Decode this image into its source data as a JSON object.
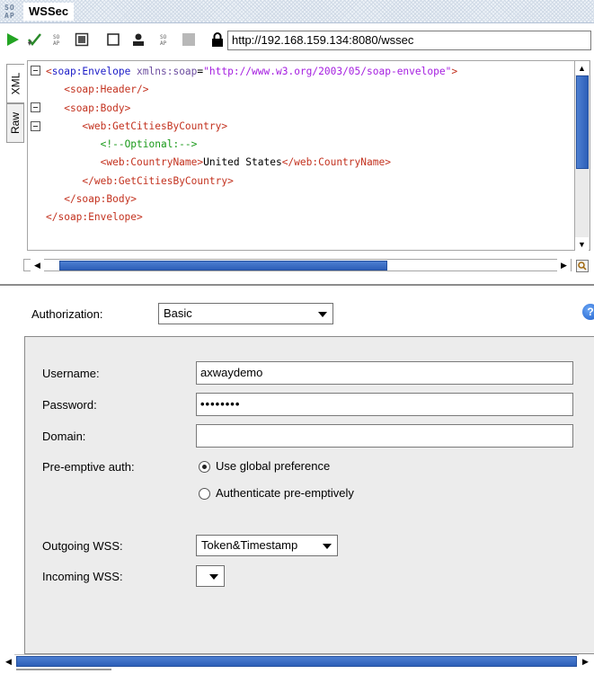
{
  "window": {
    "logo_text": "SO\nAP",
    "title": "WSSec"
  },
  "toolbar": {
    "icons": [
      "play-icon",
      "check-run-icon",
      "wss-icon",
      "schema-icon",
      "square-icon",
      "user-icon",
      "wsdl-icon",
      "stop-icon"
    ],
    "url": "http://192.168.159.134:8080/wssec"
  },
  "editor": {
    "tabs": [
      {
        "label": "XML",
        "active": true
      },
      {
        "label": "Raw",
        "active": false
      }
    ],
    "lines": [
      {
        "indent": 0,
        "parts": [
          [
            "tag",
            "<"
          ],
          [
            "ns",
            "soap:Envelope"
          ],
          [
            "attr",
            " xmlns:soap"
          ],
          [
            "txt",
            "="
          ],
          [
            "str",
            "\"http://www.w3.org/2003/05/soap-envelope\""
          ],
          [
            "tag",
            ">"
          ]
        ]
      },
      {
        "indent": 3,
        "parts": [
          [
            "tag",
            "<soap:Header/>"
          ]
        ]
      },
      {
        "indent": 3,
        "parts": [
          [
            "tag",
            "<soap:Body>"
          ]
        ]
      },
      {
        "indent": 6,
        "parts": [
          [
            "tag",
            "<web:GetCitiesByCountry>"
          ]
        ]
      },
      {
        "indent": 9,
        "parts": [
          [
            "cmt",
            "<!--Optional:-->"
          ]
        ]
      },
      {
        "indent": 9,
        "parts": [
          [
            "tag",
            "<web:CountryName>"
          ],
          [
            "txt",
            "United States"
          ],
          [
            "tag",
            "</web:CountryName>"
          ]
        ]
      },
      {
        "indent": 6,
        "parts": [
          [
            "tag",
            "</web:GetCitiesByCountry>"
          ]
        ]
      },
      {
        "indent": 3,
        "parts": [
          [
            "tag",
            "</soap:Body>"
          ]
        ]
      },
      {
        "indent": 0,
        "parts": [
          [
            "tag",
            "</soap:Envelope>"
          ]
        ]
      }
    ]
  },
  "auth": {
    "authorization_label": "Authorization:",
    "authorization_value": "Basic",
    "help_glyph": "?",
    "username_label": "Username:",
    "username_value": "axwaydemo",
    "password_label": "Password:",
    "password_value": "••••••••",
    "domain_label": "Domain:",
    "domain_value": "",
    "preemptive_label": "Pre-emptive auth:",
    "radio_global": "Use global preference",
    "radio_preemptive": "Authenticate pre-emptively",
    "outgoing_label": "Outgoing WSS:",
    "outgoing_value": "Token&Timestamp",
    "incoming_label": "Incoming WSS:",
    "incoming_value": ""
  },
  "colors": {
    "tag": "#c3321f",
    "namespace": "#1d1dc8",
    "string": "#a51ee0",
    "comment": "#1a9a1a",
    "scroll_thumb": "#2d5fb8"
  }
}
